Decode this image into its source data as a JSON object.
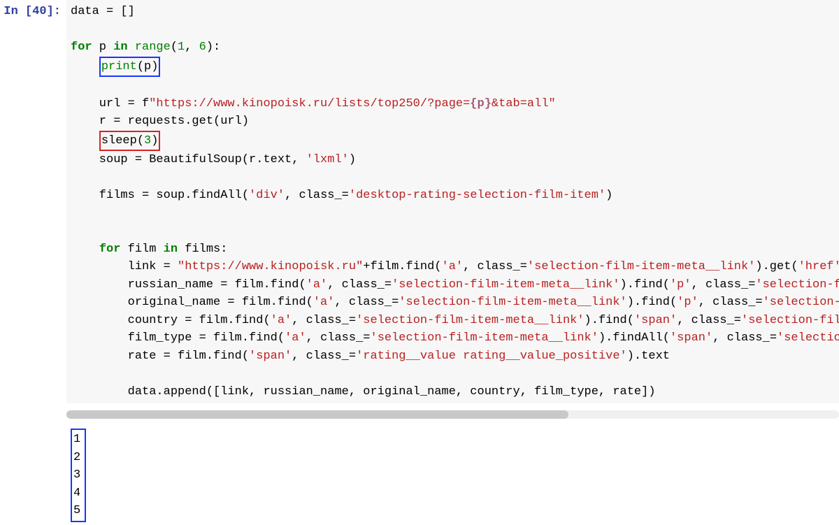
{
  "cell": {
    "prompt_prefix": "In [",
    "prompt_number": "40",
    "prompt_suffix": "]:",
    "code": {
      "l1": "data = []",
      "l2": "",
      "l3_a": "for",
      "l3_b": " p ",
      "l3_c": "in",
      "l3_d": " ",
      "l3_e": "range",
      "l3_f": "(",
      "l3_g": "1",
      "l3_h": ", ",
      "l3_i": "6",
      "l3_j": "):",
      "l4_a": "print",
      "l4_b": "(p)",
      "l5": "",
      "l6_a": "    url = f",
      "l6_b": "\"https://www.kinopoisk.ru/lists/top250/?page=",
      "l6_c": "{p}",
      "l6_d": "&tab=all\"",
      "l7": "    r = requests.get(url)",
      "l8_a": "sleep(",
      "l8_b": "3",
      "l8_c": ")",
      "l9_a": "    soup = BeautifulSoup(r.text, ",
      "l9_b": "'lxml'",
      "l9_c": ")",
      "l10": "",
      "l11_a": "    films = soup.findAll(",
      "l11_b": "'div'",
      "l11_c": ", class_=",
      "l11_d": "'desktop-rating-selection-film-item'",
      "l11_e": ")",
      "l12": "",
      "l13": "",
      "l14_a": "    ",
      "l14_b": "for",
      "l14_c": " film ",
      "l14_d": "in",
      "l14_e": " films:",
      "l15_a": "        link = ",
      "l15_b": "\"https://www.kinopoisk.ru\"",
      "l15_c": "+film.find(",
      "l15_d": "'a'",
      "l15_e": ", class_=",
      "l15_f": "'selection-film-item-meta__link'",
      "l15_g": ").get(",
      "l15_h": "'href'",
      "l15_i": ")",
      "l16_a": "        russian_name = film.find(",
      "l16_b": "'a'",
      "l16_c": ", class_=",
      "l16_d": "'selection-film-item-meta__link'",
      "l16_e": ").find(",
      "l16_f": "'p'",
      "l16_g": ", class_=",
      "l16_h": "'selection-film-item",
      "l17_a": "        original_name = film.find(",
      "l17_b": "'a'",
      "l17_c": ", class_=",
      "l17_d": "'selection-film-item-meta__link'",
      "l17_e": ").find(",
      "l17_f": "'p'",
      "l17_g": ", class_=",
      "l17_h": "'selection-film-ite",
      "l18_a": "        country = film.find(",
      "l18_b": "'a'",
      "l18_c": ", class_=",
      "l18_d": "'selection-film-item-meta__link'",
      "l18_e": ").find(",
      "l18_f": "'span'",
      "l18_g": ", class_=",
      "l18_h": "'selection-film-item-m",
      "l19_a": "        film_type = film.find(",
      "l19_b": "'a'",
      "l19_c": ", class_=",
      "l19_d": "'selection-film-item-meta__link'",
      "l19_e": ").findAll(",
      "l19_f": "'span'",
      "l19_g": ", class_=",
      "l19_h": "'selection-film-i",
      "l20_a": "        rate = film.find(",
      "l20_b": "'span'",
      "l20_c": ", class_=",
      "l20_d": "'rating__value rating__value_positive'",
      "l20_e": ").text",
      "l21": "",
      "l22": "        data.append([link, russian_name, original_name, country, film_type, rate])",
      "l23": ""
    }
  },
  "output": {
    "lines": [
      "1",
      "2",
      "3",
      "4",
      "5"
    ]
  }
}
